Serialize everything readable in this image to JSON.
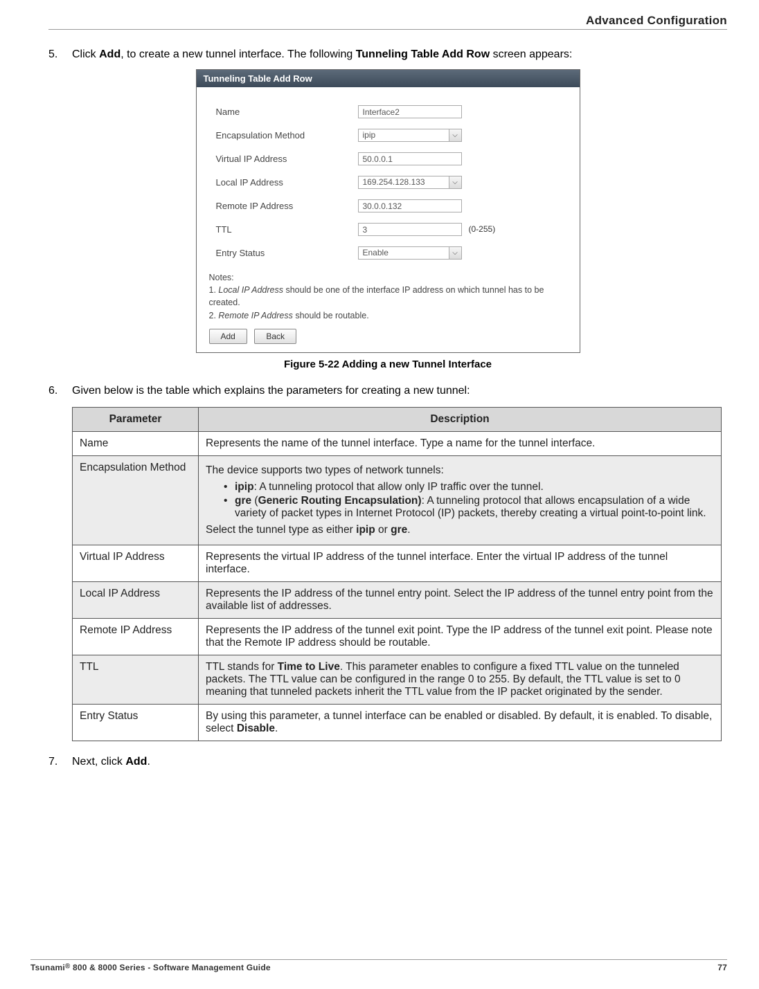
{
  "header": {
    "section": "Advanced Configuration"
  },
  "steps": [
    {
      "num": "5.",
      "html": "Click <b>Add</b>, to create a new tunnel interface. The following <b>Tunneling Table Add Row</b> screen appears:"
    },
    {
      "num": "6.",
      "html": "Given below is the table which explains the parameters for creating a new tunnel:"
    },
    {
      "num": "7.",
      "html": "Next, click <b>Add</b>."
    }
  ],
  "screenshot": {
    "title": "Tunneling Table Add Row",
    "fields": [
      {
        "label": "Name",
        "type": "text",
        "value": "Interface2"
      },
      {
        "label": "Encapsulation Method",
        "type": "select",
        "value": "ipip"
      },
      {
        "label": "Virtual IP Address",
        "type": "text",
        "value": "50.0.0.1"
      },
      {
        "label": "Local IP Address",
        "type": "select",
        "value": "169.254.128.133"
      },
      {
        "label": "Remote IP Address",
        "type": "text",
        "value": "30.0.0.132"
      },
      {
        "label": "TTL",
        "type": "text",
        "value": "3",
        "hint": "(0-255)"
      },
      {
        "label": "Entry Status",
        "type": "select",
        "value": "Enable"
      }
    ],
    "notes_title": "Notes:",
    "notes": [
      {
        "html": "<span class=\"italic\">Local IP Address</span> should be one of the interface IP address on which tunnel has to be created."
      },
      {
        "html": "<span class=\"italic\">Remote IP Address</span> should be routable."
      }
    ],
    "buttons": {
      "add": "Add",
      "back": "Back"
    }
  },
  "figure_caption": "Figure 5-22 Adding a new Tunnel Interface",
  "param_table": {
    "headers": {
      "param": "Parameter",
      "desc": "Description"
    },
    "rows": [
      {
        "param": "Name",
        "desc_html": "Represents the name of the tunnel interface. Type a name for the tunnel interface.",
        "alt": false
      },
      {
        "param": "Encapsulation Method",
        "desc_html": "<p>The device supports two types of network tunnels:</p><ul><li><b>ipip</b>: A tunneling protocol that allow only IP traffic over the tunnel.</li><li><b>gre</b> (<b>Generic Routing Encapsulation)</b>: A tunneling protocol that allows encapsulation of a wide variety of packet types in Internet Protocol (IP) packets, thereby creating a virtual point-to-point link.</li></ul><p>Select the tunnel type as either <b>ipip</b> or <b>gre</b>.</p>",
        "alt": true
      },
      {
        "param": "Virtual IP Address",
        "desc_html": "Represents the virtual IP address of the tunnel interface. Enter the virtual IP address of the tunnel interface.",
        "alt": false
      },
      {
        "param": "Local IP Address",
        "desc_html": "Represents the IP address of the tunnel entry point. Select the IP address of the tunnel entry point from the available list of addresses.",
        "alt": true
      },
      {
        "param": "Remote IP Address",
        "desc_html": "Represents the IP address of the tunnel exit point. Type the IP address of the tunnel exit point. Please note that the Remote IP address should be routable.",
        "alt": false
      },
      {
        "param": "TTL",
        "desc_html": "TTL stands for <b>Time to Live</b>. This parameter enables to configure a fixed TTL value on the tunneled packets. The TTL value can be configured in the range 0 to 255. By default, the TTL value is set to 0 meaning that tunneled packets inherit the TTL value from the IP packet originated by the sender.",
        "alt": true
      },
      {
        "param": "Entry Status",
        "desc_html": "By using this parameter, a tunnel interface can be enabled or disabled. By default, it is enabled. To disable, select <b>Disable</b>.",
        "alt": false
      }
    ]
  },
  "footer": {
    "left_prefix": "Tsunami",
    "left_suffix": " 800 & 8000 Series - Software Management Guide",
    "page": "77"
  }
}
